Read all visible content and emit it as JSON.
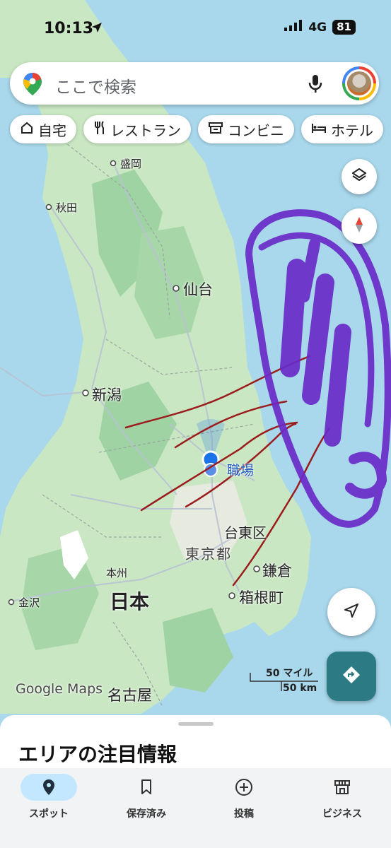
{
  "status_bar": {
    "time": "10:13",
    "network": "4G",
    "battery": "81"
  },
  "search": {
    "placeholder": "ここで検索"
  },
  "chips": [
    {
      "label": "自宅",
      "icon": "home-icon"
    },
    {
      "label": "レストラン",
      "icon": "restaurant-icon"
    },
    {
      "label": "コンビニ",
      "icon": "store-icon"
    },
    {
      "label": "ホテル",
      "icon": "hotel-icon"
    }
  ],
  "map_labels": {
    "morioka": "盛岡",
    "akita": "秋田",
    "sendai": "仙台",
    "niigata": "新潟",
    "work": "職場",
    "taito": "台東区",
    "tokyo": "東京都",
    "kamakura": "鎌倉",
    "hakone": "箱根町",
    "honshu": "本州",
    "japan": "日本",
    "kanazawa": "金沢",
    "nagoya": "名古屋"
  },
  "watermark": "Google Maps",
  "scale": {
    "miles": "50 マイル",
    "km": "50 km"
  },
  "sheet": {
    "title": "エリアの注目情報"
  },
  "tabs": [
    {
      "label": "スポット",
      "icon": "location-pin-icon",
      "active": true
    },
    {
      "label": "保存済み",
      "icon": "bookmark-icon",
      "active": false
    },
    {
      "label": "投稿",
      "icon": "add-circle-icon",
      "active": false
    },
    {
      "label": "ビジネス",
      "icon": "store-icon",
      "active": false
    }
  ],
  "colors": {
    "water": "#a9d8ec",
    "land": "#c9e7c2",
    "forest": "#9fd3a3",
    "accent": "#2b7a84",
    "annotation_red": "#9b1c1c",
    "annotation_purple": "#6a2bc8"
  }
}
